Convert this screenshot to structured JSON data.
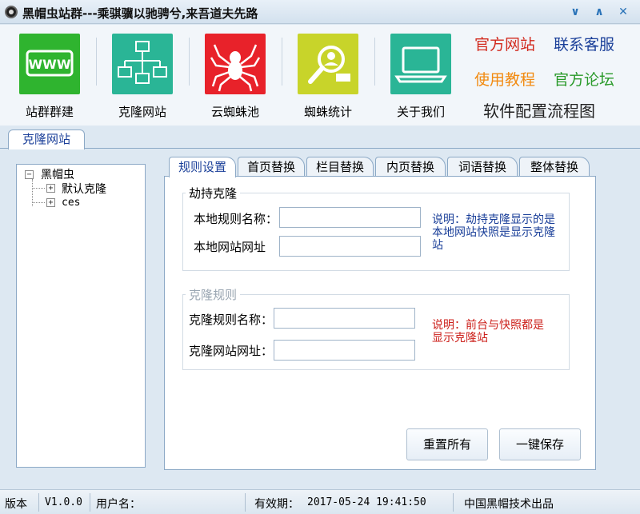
{
  "window": {
    "title": "黑帽虫站群---乘骐骥以驰骋兮,来吾道夫先路",
    "controls": [
      "∨",
      "∧",
      "✕"
    ]
  },
  "toolbar": {
    "tools": [
      {
        "label": "站群群建",
        "icon": "www-icon",
        "color": "#2fb42f"
      },
      {
        "label": "克隆网站",
        "icon": "network-icon",
        "color": "#2ab596"
      },
      {
        "label": "云蜘蛛池",
        "icon": "spider-icon",
        "color": "#e8222a"
      },
      {
        "label": "蜘蛛统计",
        "icon": "search-user-icon",
        "color": "#c8d42a"
      },
      {
        "label": "关于我们",
        "icon": "laptop-icon",
        "color": "#2ab596"
      }
    ],
    "links": {
      "official_site": {
        "label": "官方网站",
        "color": "#d22a1e"
      },
      "contact_support": {
        "label": "联系客服",
        "color": "#1a3f99"
      },
      "tutorial": {
        "label": "使用教程",
        "color": "#f28a10"
      },
      "forum": {
        "label": "官方论坛",
        "color": "#2a9a2a"
      },
      "config_flow": {
        "label": "软件配置流程图"
      }
    }
  },
  "main_tab": {
    "label": "克隆网站"
  },
  "tree": {
    "root": "黑帽虫",
    "children": [
      "默认克隆",
      "ces"
    ]
  },
  "subtabs": [
    "规则设置",
    "首页替换",
    "栏目替换",
    "内页替换",
    "词语替换",
    "整体替换"
  ],
  "hijack_group": {
    "legend": "劫持克隆",
    "rule_name_label": "本地规则名称：",
    "rule_name_value": "",
    "url_label": "本地网站网址",
    "url_value": "",
    "note": "说明：劫持克隆显示的是本地网站快照是显示克隆站",
    "note_color": "#1a3f99"
  },
  "clone_group": {
    "legend": "克隆规则",
    "rule_name_label": "克隆规则名称：",
    "rule_name_value": "",
    "url_label": "克隆网站网址：",
    "url_value": "",
    "note": "说明：前台与快照都是显示克隆站",
    "note_color": "#cc1f1a"
  },
  "buttons": {
    "reset_all": "重置所有",
    "save_all": "一键保存"
  },
  "statusbar": {
    "version_label": "版本",
    "version": "V1.0.0",
    "user_label": "用户名：",
    "user": "",
    "expire_label": "有效期：",
    "expire": "2017-05-24 19:41:50",
    "publisher": "中国黑帽技术出品"
  }
}
